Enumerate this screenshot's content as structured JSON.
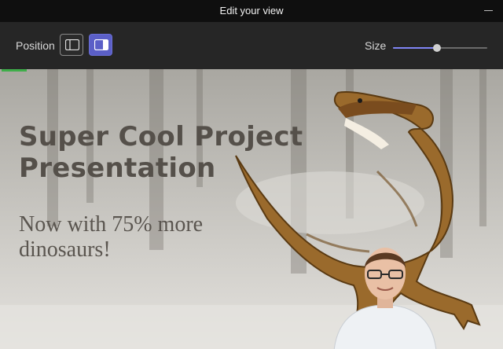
{
  "window": {
    "title": "Edit your view"
  },
  "toolbar": {
    "position_label": "Position",
    "size_label": "Size",
    "size_value": 0.47,
    "position_options": [
      {
        "icon": "layout-left-icon",
        "selected": false
      },
      {
        "icon": "layout-right-icon",
        "selected": true
      }
    ],
    "accent_color": "#5b5fc7"
  },
  "slide": {
    "title": "Super Cool Project Presentation",
    "subtitle": "Now with 75% more dinosaurs!"
  },
  "colors": {
    "titlebar_bg": "#0f0f0f",
    "toolbar_bg": "#262626",
    "slider_fill": "#7f85f5"
  }
}
